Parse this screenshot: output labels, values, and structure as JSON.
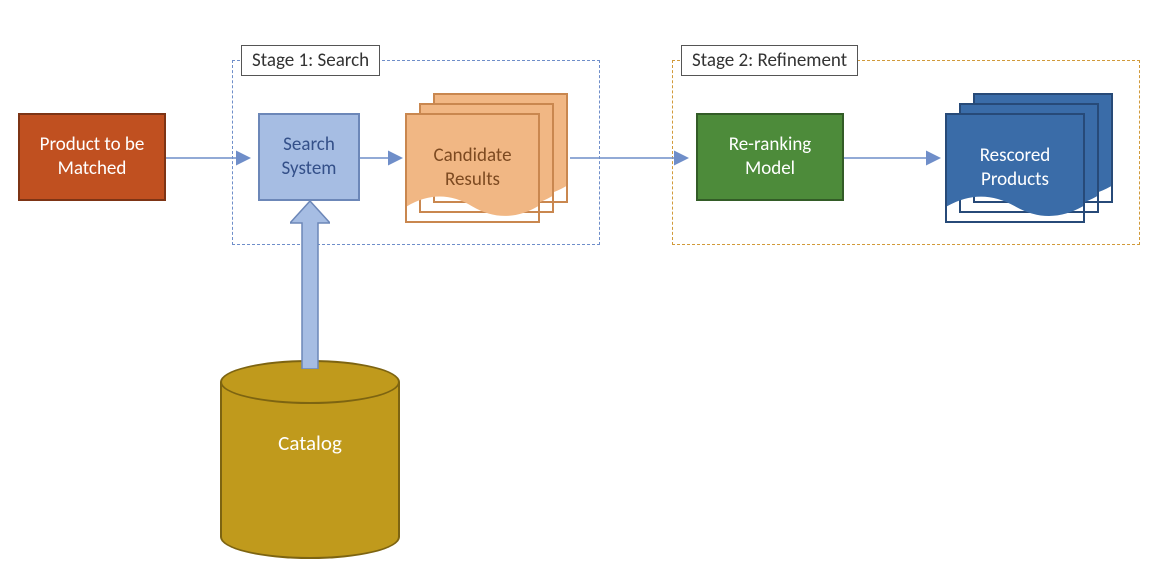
{
  "nodes": {
    "product": {
      "label": "Product to be Matched"
    },
    "search": {
      "label": "Search System"
    },
    "candidates": {
      "label": "Candidate Results"
    },
    "rerank": {
      "label": "Re-ranking Model"
    },
    "rescored": {
      "label": "Rescored Products"
    },
    "catalog": {
      "label": "Catalog"
    }
  },
  "stages": {
    "stage1": {
      "label": "Stage 1: Search"
    },
    "stage2": {
      "label": "Stage 2: Refinement"
    }
  },
  "arrows": [
    {
      "from": "product",
      "to": "search"
    },
    {
      "from": "search",
      "to": "candidates"
    },
    {
      "from": "candidates",
      "to": "rerank"
    },
    {
      "from": "rerank",
      "to": "rescored"
    },
    {
      "from": "catalog",
      "to": "search"
    }
  ],
  "colors": {
    "product_fill": "#c05020",
    "search_fill": "#a6bde3",
    "search_text": "#345089",
    "candidate_fill": "#f1b784",
    "candidate_edge": "#c9874f",
    "rerank_fill": "#4d8b3a",
    "rescored_fill": "#3a6ca8",
    "rescored_edge": "#274a78",
    "catalog_fill": "#c09a1c",
    "stage1_border": "#6f8ec9",
    "stage2_border": "#d19a3a",
    "arrow": "#6f8ec9"
  }
}
